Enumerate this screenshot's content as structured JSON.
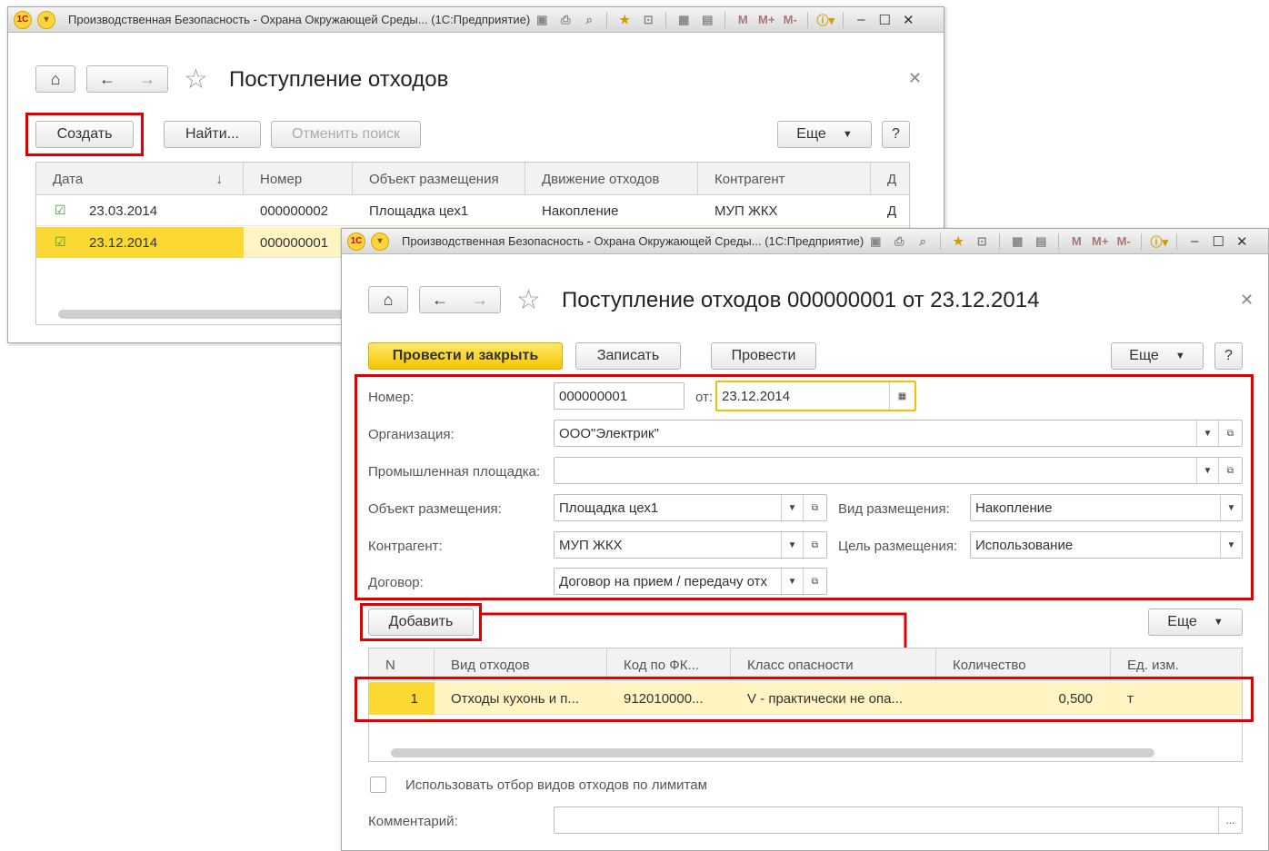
{
  "list_window": {
    "title_bar": "Производственная Безопасность - Охрана Окружающей Среды... (1С:Предприятие)",
    "form_title": "Поступление отходов",
    "buttons": {
      "create": "Создать",
      "find": "Найти...",
      "cancel_search": "Отменить поиск",
      "more": "Еще",
      "help": "?"
    },
    "columns": [
      "Дата",
      "Номер",
      "Объект размещения",
      "Движение отходов",
      "Контрагент",
      "Д"
    ],
    "sort_indicator": "↓",
    "rows": [
      {
        "date": "23.03.2014",
        "number": "000000002",
        "object": "Площадка цех1",
        "movement": "Накопление",
        "counterparty": "МУП ЖКХ",
        "extra": "Д"
      },
      {
        "date": "23.12.2014",
        "number": "000000001"
      }
    ]
  },
  "doc_window": {
    "title_bar": "Производственная Безопасность - Охрана Окружающей Среды... (1С:Предприятие)",
    "form_title": "Поступление отходов 000000001 от 23.12.2014",
    "buttons": {
      "post_close": "Провести и закрыть",
      "save": "Записать",
      "post": "Провести",
      "more": "Еще",
      "help": "?",
      "add": "Добавить",
      "table_more": "Еще"
    },
    "fields": {
      "number_label": "Номер:",
      "number": "000000001",
      "date_label": "от:",
      "date": "23.12.2014",
      "org_label": "Организация:",
      "org": "ООО\"Электрик\"",
      "site_label": "Промышленная площадка:",
      "site": "",
      "object_label": "Объект размещения:",
      "object": "Площадка цех1",
      "placement_type_label": "Вид размещения:",
      "placement_type": "Накопление",
      "counterparty_label": "Контрагент:",
      "counterparty": "МУП ЖКХ",
      "purpose_label": "Цель размещения:",
      "purpose": "Использование",
      "contract_label": "Договор:",
      "contract": "Договор на прием / передачу отх"
    },
    "table": {
      "columns": [
        "N",
        "Вид отходов",
        "Код по ФК...",
        "Класс опасности",
        "Количество",
        "Ед. изм."
      ],
      "rows": [
        {
          "n": "1",
          "waste": "Отходы кухонь и п...",
          "code": "912010000...",
          "class": "V - практически не опа...",
          "qty": "0,500",
          "unit": "т"
        }
      ]
    },
    "checkbox_label": "Использовать отбор видов отходов по лимитам",
    "comment_label": "Комментарий:",
    "comment_button": "..."
  },
  "titlebar_tools": {
    "m": "M",
    "mplus": "M+",
    "mminus": "M-",
    "info": "i",
    "minimize": "–",
    "maximize": "☐",
    "close": "✕"
  },
  "colors": {
    "accent_yellow": "#fbd932",
    "highlight_red": "#e00000"
  }
}
